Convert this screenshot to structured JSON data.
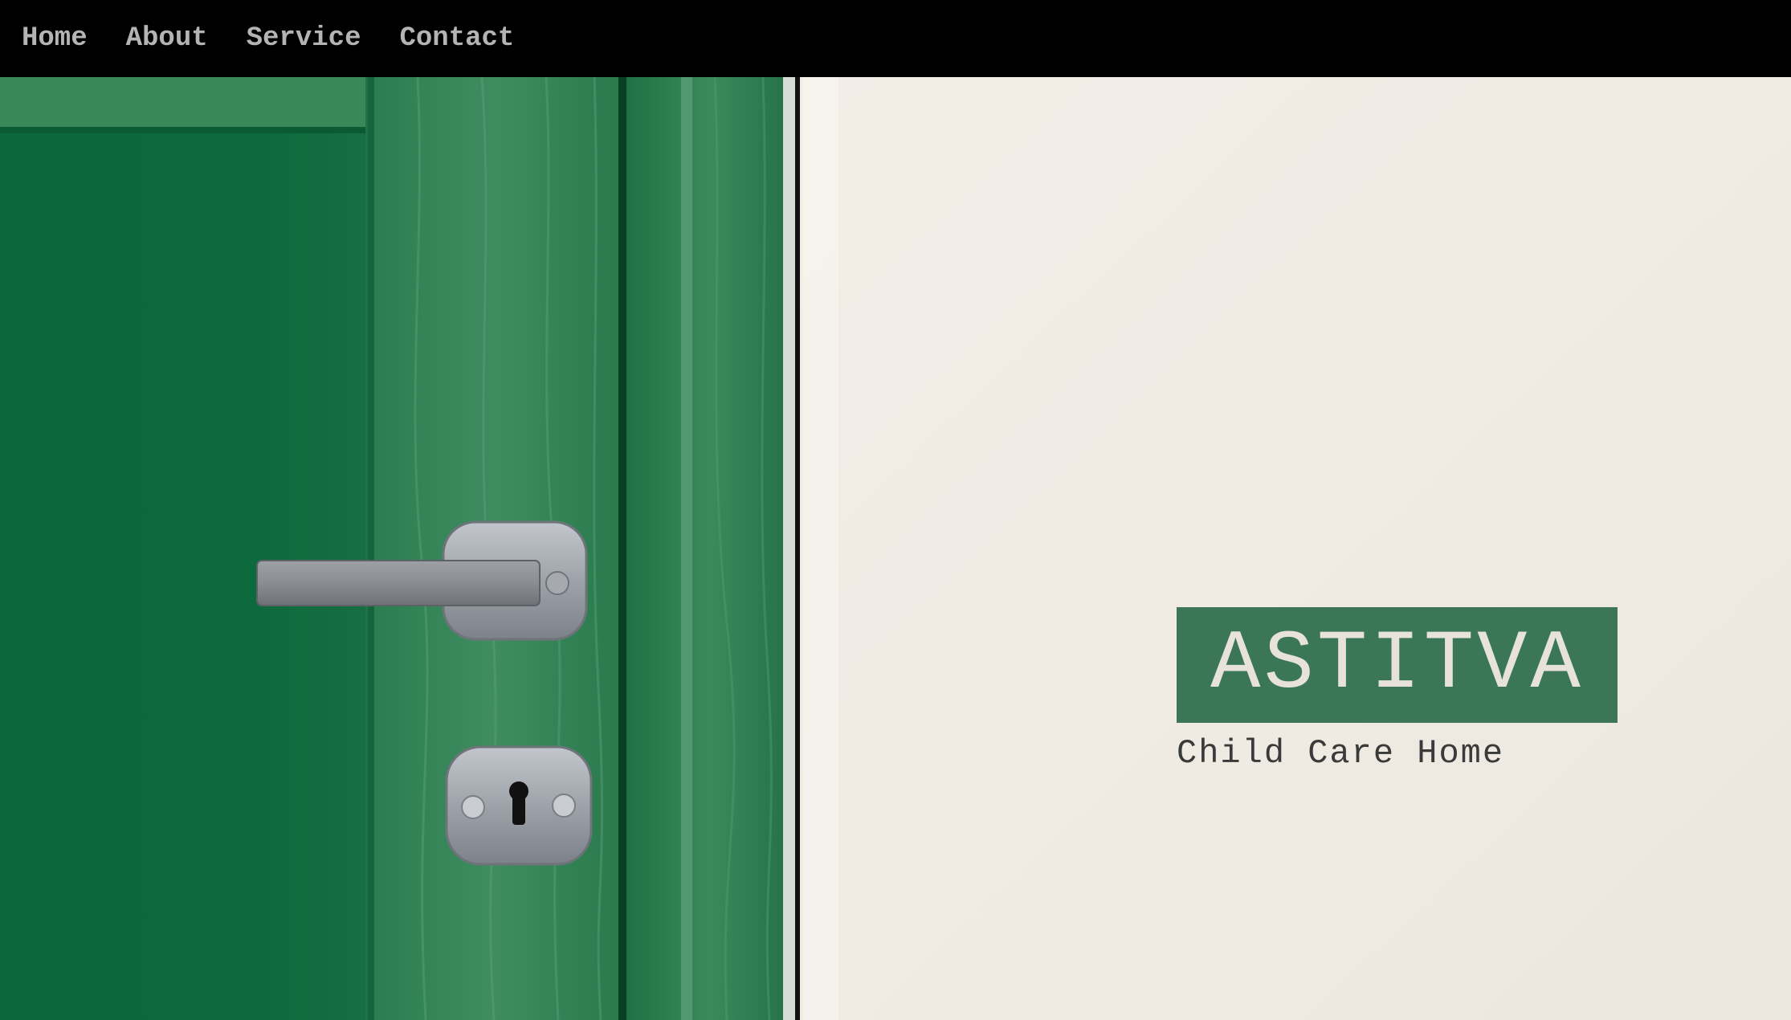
{
  "nav": {
    "items": [
      {
        "label": "Home"
      },
      {
        "label": "About"
      },
      {
        "label": "Service"
      },
      {
        "label": "Contact"
      }
    ]
  },
  "hero": {
    "title": "ASTITVA",
    "tagline": "Child Care Home",
    "image_icon": "green-door-photo"
  },
  "colors": {
    "nav_bg": "#000000",
    "nav_text": "#b4b4b4",
    "door_green": "#0f6a3c",
    "wall": "#f0ece4",
    "brand_box": "#3b7657",
    "brand_text": "#e7e3da",
    "tagline_text": "#3a3a3a"
  }
}
